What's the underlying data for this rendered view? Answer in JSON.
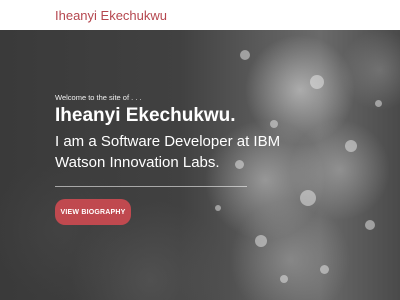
{
  "header": {
    "brand": "Iheanyi Ekechukwu"
  },
  "hero": {
    "intro": "Welcome to the site of . . .",
    "name": "Iheanyi Ekechukwu.",
    "tagline": "I am a Software Developer at IBM Watson Innovation Labs.",
    "button_label": "VIEW BIOGRAPHY"
  },
  "colors": {
    "accent": "#c0494f",
    "brand_text": "#b5474f"
  }
}
